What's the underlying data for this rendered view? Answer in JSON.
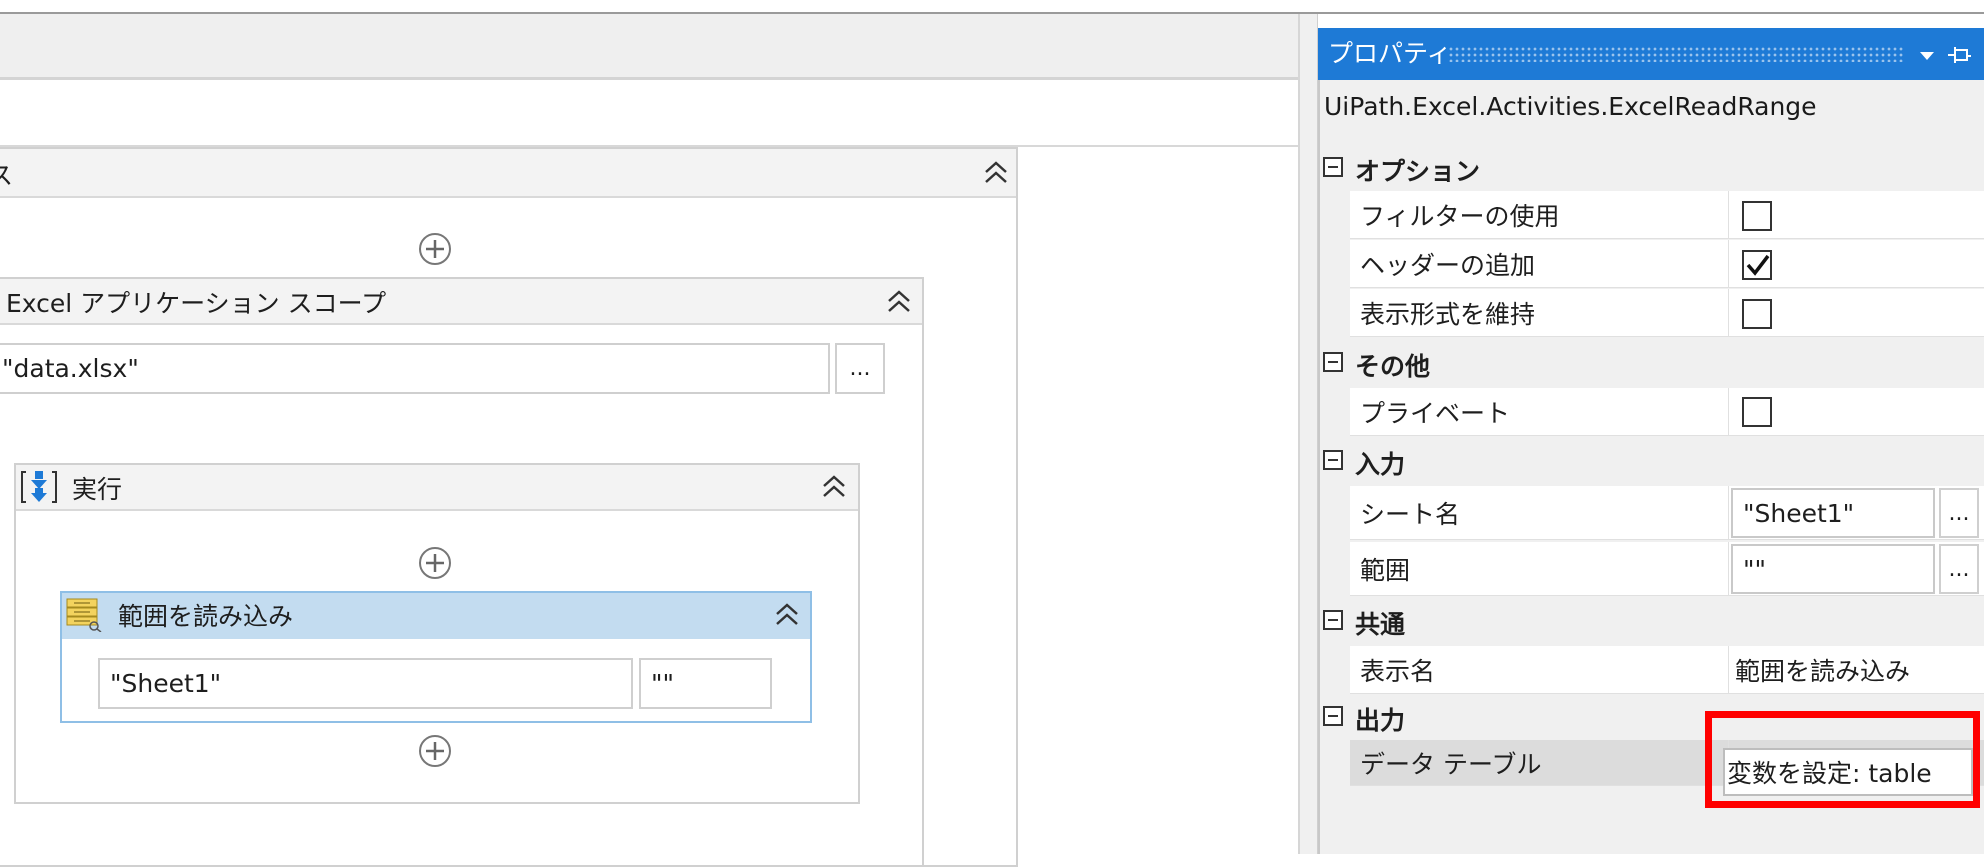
{
  "designer": {
    "outer_scope": {
      "title": "ス"
    },
    "excel_scope": {
      "title": "Excel アプリケーション スコープ",
      "path_value": "\"data.xlsx\"",
      "browse_label": "..."
    },
    "do_sequence": {
      "title": "実行"
    },
    "read_range": {
      "title": "範囲を読み込み",
      "sheet_value": "\"Sheet1\"",
      "range_value": "\"\""
    }
  },
  "properties": {
    "panel_title": "プロパティ",
    "type_name": "UiPath.Excel.Activities.ExcelReadRange",
    "categories": {
      "options": {
        "label": "オプション",
        "items": [
          {
            "label": "フィルターの使用",
            "checked": false
          },
          {
            "label": "ヘッダーの追加",
            "checked": true
          },
          {
            "label": "表示形式を維持",
            "checked": false
          }
        ]
      },
      "misc": {
        "label": "その他",
        "items": [
          {
            "label": "プライベート",
            "checked": false
          }
        ]
      },
      "input": {
        "label": "入力",
        "items": [
          {
            "label": "シート名",
            "value": "\"Sheet1\""
          },
          {
            "label": "範囲",
            "value": "\"\""
          }
        ],
        "browse_label": "..."
      },
      "common": {
        "label": "共通",
        "items": [
          {
            "label": "表示名",
            "value": "範囲を読み込み"
          }
        ]
      },
      "output": {
        "label": "出力",
        "items": [
          {
            "label": "データ テーブル",
            "value": "変数を設定:  table"
          }
        ]
      }
    }
  },
  "colors": {
    "panel_title_bg": "#1e7ad6",
    "selected_activity_bg": "#c3dcf0",
    "selected_activity_border": "#8fbfe6",
    "highlight": "#ff0000"
  }
}
